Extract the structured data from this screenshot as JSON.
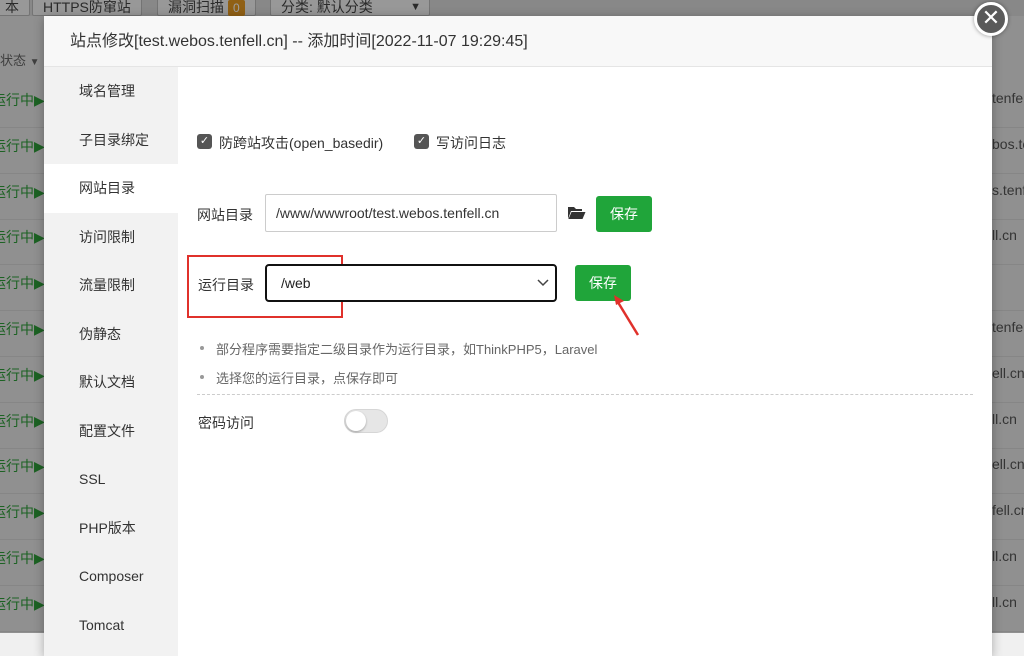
{
  "background": {
    "toolbar": {
      "partial_label": "本",
      "https_label": "HTTPS防窜站",
      "scan_label": "漏洞扫描",
      "scan_count": "0",
      "category_label": "分类: 默认分类"
    },
    "table_header": "状态",
    "row_status": "运行中▶",
    "right_fragments": [
      "tenfell",
      "bos.tenf",
      "s.tenf",
      "ll.cn",
      "",
      "tenfe",
      "ell.cn",
      "ll.cn",
      "ell.cn",
      "fell.cn",
      "ll.cn",
      "ll.cn"
    ]
  },
  "modal": {
    "title": "站点修改[test.webos.tenfell.cn] -- 添加时间[2022-11-07 19:29:45]",
    "close_symbol": "✕",
    "sidebar": [
      "域名管理",
      "子目录绑定",
      "网站目录",
      "访问限制",
      "流量限制",
      "伪静态",
      "默认文档",
      "配置文件",
      "SSL",
      "PHP版本",
      "Composer",
      "Tomcat"
    ],
    "active_index": 2,
    "options": {
      "anti_xss_label": "防跨站攻击(open_basedir)",
      "access_log_label": "写访问日志",
      "check_mark": "✓"
    },
    "site_dir": {
      "label": "网站目录",
      "value": "/www/wwwroot/test.webos.tenfell.cn",
      "save_label": "保存"
    },
    "run_dir": {
      "label": "运行目录",
      "value": "/web",
      "save_label": "保存"
    },
    "tips": [
      "部分程序需要指定二级目录作为运行目录，如ThinkPHP5，Laravel",
      "选择您的运行目录，点保存即可"
    ],
    "password_access": {
      "label": "密码访问",
      "enabled": false
    }
  },
  "colors": {
    "accent_green": "#20a53a",
    "highlight_red": "#e0312b"
  }
}
